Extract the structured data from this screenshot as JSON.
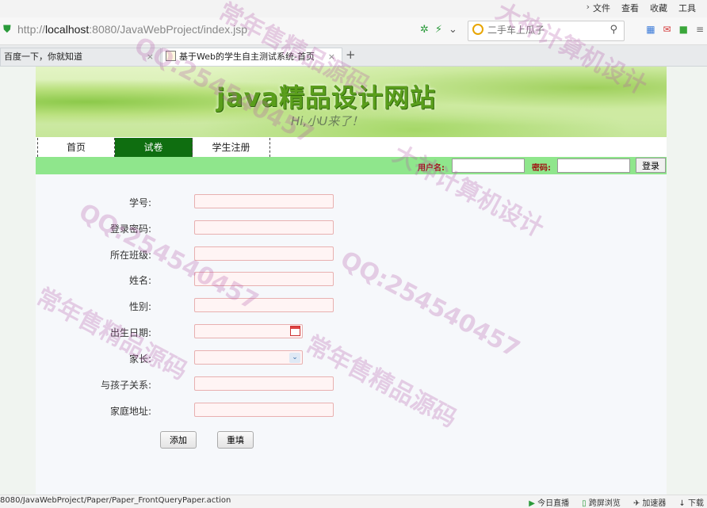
{
  "browser": {
    "menu": [
      "文件",
      "查看",
      "收藏",
      "工具"
    ],
    "url_prefix": "http://",
    "url_host": "localhost",
    "url_rest": ":8080/JavaWebProject/index.jsp",
    "search_placeholder": "二手车上瓜子",
    "tabs": [
      {
        "label": "百度一下，你就知道"
      },
      {
        "label": "基于Web的学生自主测试系统-首页"
      }
    ]
  },
  "banner": {
    "title": "java精品设计网站",
    "subtitle": "Hi,小U来了！"
  },
  "nav": {
    "items": [
      "首页",
      "试卷",
      "学生注册"
    ],
    "active": "试卷"
  },
  "login": {
    "username_label": "用户名:",
    "password_label": "密码:",
    "button": "登录"
  },
  "form": {
    "fields": [
      {
        "label": "学号:",
        "type": "text"
      },
      {
        "label": "登录密码:",
        "type": "password"
      },
      {
        "label": "所在班级:",
        "type": "text"
      },
      {
        "label": "姓名:",
        "type": "text"
      },
      {
        "label": "性别:",
        "type": "text"
      },
      {
        "label": "出生日期:",
        "type": "date"
      },
      {
        "label": "家长:",
        "type": "select"
      },
      {
        "label": "与孩子关系:",
        "type": "text"
      },
      {
        "label": "家庭地址:",
        "type": "text"
      }
    ],
    "add_button": "添加",
    "reset_button": "重填"
  },
  "statusbar": {
    "path": "8080/JavaWebProject/Paper/Paper_FrontQueryPaper.action",
    "items": [
      "今日直播",
      "跨屏浏览",
      "加速器",
      "下载"
    ]
  },
  "watermark": {
    "lines": [
      "常年售精品源码",
      "QQ:254540457",
      "大神计算机设计",
      "QQ:254540457",
      "常年售精品源码",
      "大神计算机设计",
      "QQ:254540457",
      "常年售精品源码"
    ]
  }
}
